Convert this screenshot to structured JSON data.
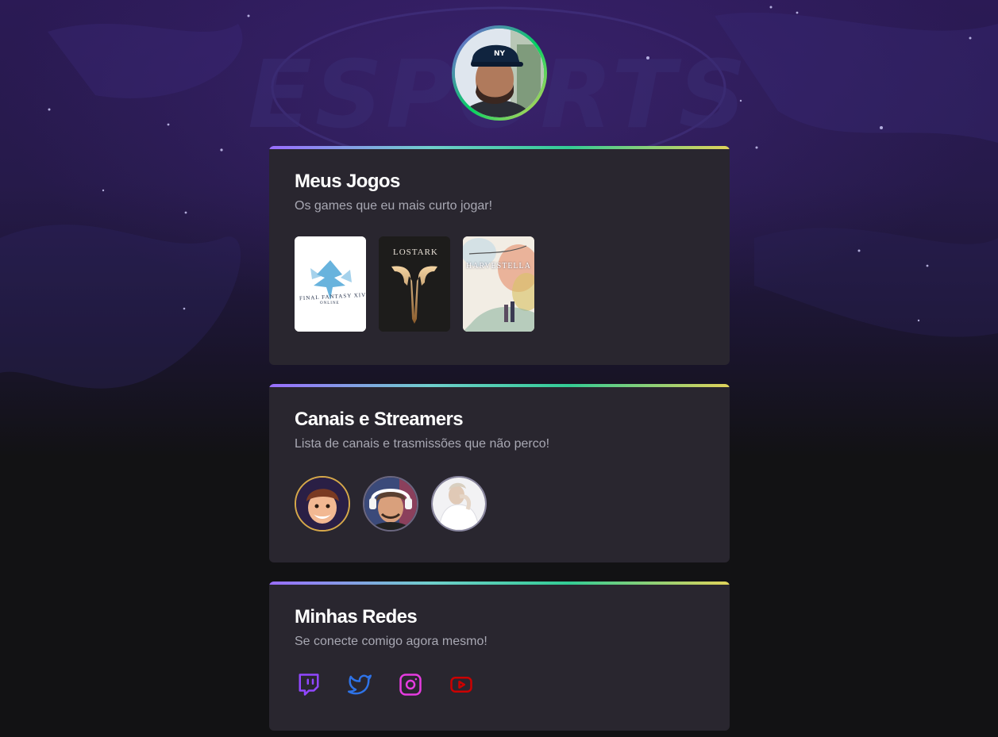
{
  "profile": {
    "avatar_alt": "Foto de perfil"
  },
  "sections": {
    "games": {
      "title": "Meus Jogos",
      "subtitle": "Os games que eu mais curto jogar!",
      "items": [
        {
          "name": "FINAL FANTASY XIV",
          "label": "FINAL FANTASY XIV",
          "sublabel": "ONLINE"
        },
        {
          "name": "Lost Ark",
          "label": "LOSTARK"
        },
        {
          "name": "Harvestella",
          "label": "HARVESTELLA"
        }
      ]
    },
    "streamers": {
      "title": "Canais e Streamers",
      "subtitle": "Lista de canais e trasmissões que não perco!",
      "items": [
        {
          "name": "streamer-1"
        },
        {
          "name": "streamer-2"
        },
        {
          "name": "streamer-3"
        }
      ]
    },
    "socials": {
      "title": "Minhas Redes",
      "subtitle": "Se conecte comigo agora mesmo!",
      "items": [
        {
          "name": "twitch",
          "icon": "twitch-icon",
          "color": "#9147ff"
        },
        {
          "name": "twitter",
          "icon": "twitter-icon",
          "color": "#2e73e8"
        },
        {
          "name": "instagram",
          "icon": "instagram-icon",
          "color": "#e63ce0"
        },
        {
          "name": "youtube",
          "icon": "youtube-icon",
          "color": "#cc0000"
        }
      ]
    }
  },
  "background": {
    "watermark": "ESPORTS"
  }
}
